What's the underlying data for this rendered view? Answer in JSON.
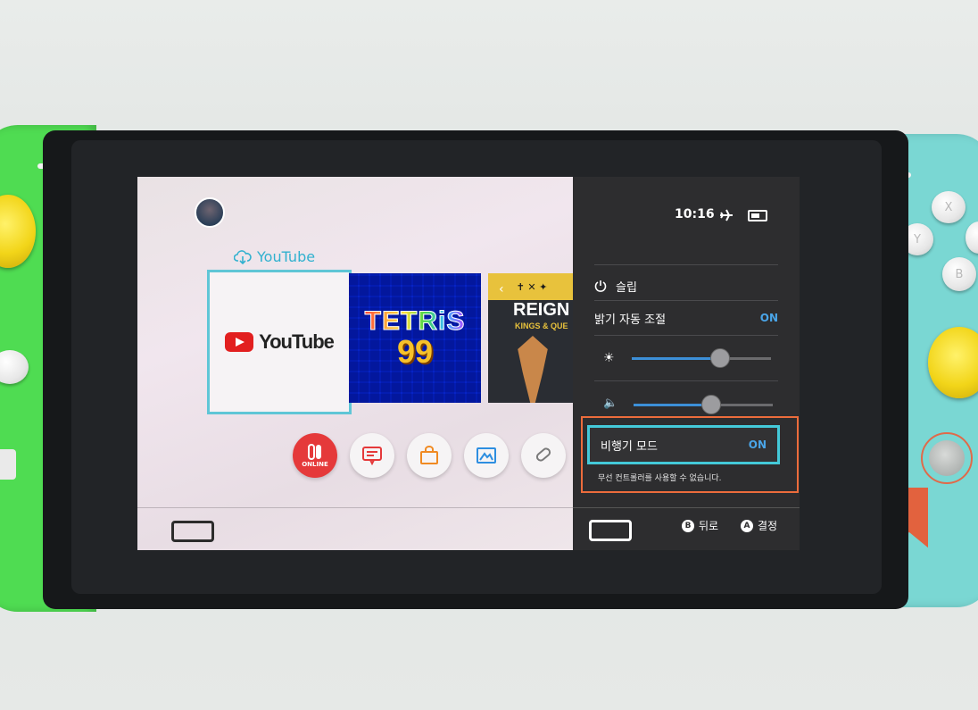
{
  "status": {
    "time": "10:16",
    "airplane_icon": "airplane-icon",
    "battery_icon": "battery-icon"
  },
  "home": {
    "tile_caption": "YouTube",
    "tiles": [
      {
        "name": "YouTube",
        "logo_text": "YouTube"
      },
      {
        "name": "TETRIS 99",
        "title": "TETRiS",
        "number": "99"
      },
      {
        "name": "REIGNS",
        "title": "REIGN",
        "subtitle": "KINGS & QUE"
      }
    ],
    "online_label": "ONLINE"
  },
  "overlay": {
    "sleep_label": "슬립",
    "auto_brightness_label": "밝기 자동 조절",
    "auto_brightness_value": "ON",
    "brightness_level": 0.63,
    "volume_level": 0.55,
    "airplane_label": "비행기 모드",
    "airplane_value": "ON",
    "hint": "무선 컨트롤러를 사용할 수 없습니다.",
    "back_button": "B",
    "back_label": "뒤로",
    "ok_button": "A",
    "ok_label": "결정"
  },
  "joycon_right": {
    "x": "X",
    "y": "Y",
    "b": "B"
  },
  "colors": {
    "accent": "#44c9d9",
    "highlight": "#ec6c3c",
    "slider": "#3c8fd8",
    "online": "#e5393a",
    "joycon_left": "#4fdc52",
    "joycon_right": "#7ad7d3"
  }
}
